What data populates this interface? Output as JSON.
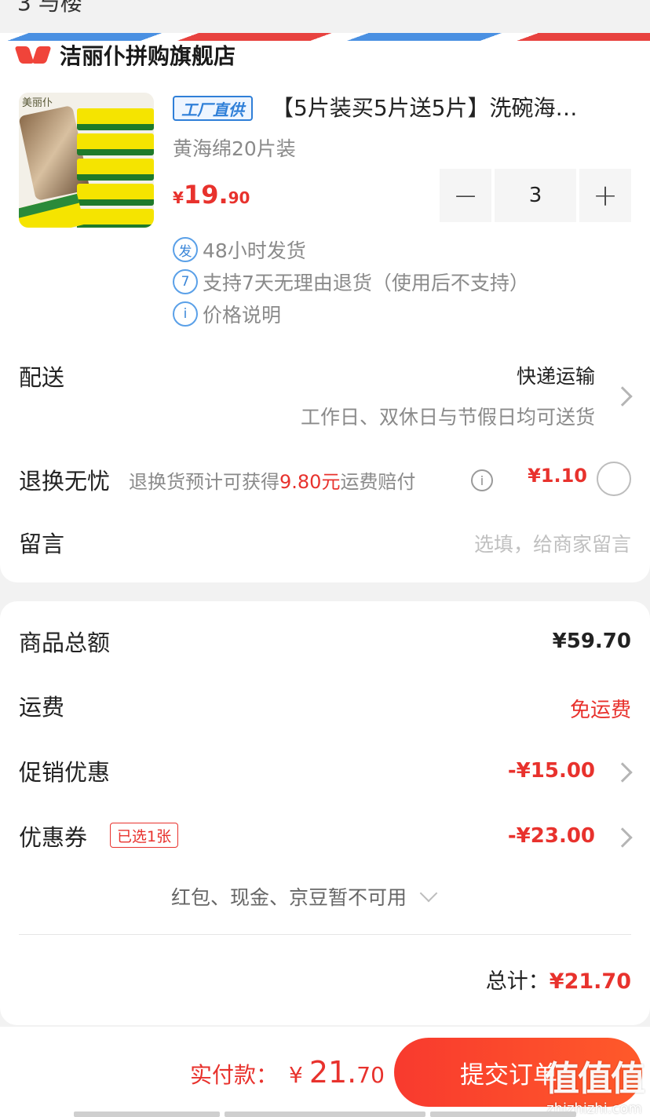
{
  "top": {
    "cut_text": "3 与楼"
  },
  "shop": {
    "name": "洁丽仆拼购旗舰店"
  },
  "product": {
    "image_brand_text": "美丽仆",
    "badge": "工厂直供",
    "title": "【5片装买5片送5片】洗碗海…",
    "sku": "黄海绵20片装",
    "price_currency": "¥",
    "price_int": "19.",
    "price_dec": "90",
    "quantity": "3",
    "minus": "−",
    "plus": "+"
  },
  "services": [
    {
      "icon_text": "发",
      "text": "48小时发货"
    },
    {
      "icon_text": "7",
      "text": "支持7天无理由退货（使用后不支持）"
    },
    {
      "icon_text": "i",
      "text": "价格说明"
    }
  ],
  "delivery": {
    "label": "配送",
    "method": "快递运输",
    "note": "工作日、双休日与节假日均可送货"
  },
  "returns": {
    "label": "退换无忧",
    "desc_prefix": "退换货预计可获得",
    "desc_amount": "9.80元",
    "desc_suffix": "运费赔付",
    "info_icon": "i",
    "price": "¥1.10"
  },
  "message": {
    "label": "留言",
    "placeholder": "选填，给商家留言"
  },
  "summary": {
    "goods_label": "商品总额",
    "goods_value": "¥59.70",
    "shipping_label": "运费",
    "shipping_value": "免运费",
    "promo_label": "促销优惠",
    "promo_value": "-¥15.00",
    "coupon_label": "优惠券",
    "coupon_tag": "已选1张",
    "coupon_value": "-¥23.00",
    "unavailable_text": "红包、现金、京豆暂不可用",
    "total_label": "总计：",
    "total_value": "¥21.70"
  },
  "footer": {
    "pay_label": "实付款：",
    "pay_currency": "¥",
    "pay_int": "21.",
    "pay_dec": "70",
    "submit_label": "提交订单"
  },
  "watermark": {
    "logo": "值值值",
    "url": "zhizhizhi.com"
  },
  "colors": {
    "accent_red": "#e8322d",
    "info_blue": "#2f7fd8",
    "button_gradient_start": "#f83a2e",
    "button_gradient_end": "#ff5a2a"
  }
}
